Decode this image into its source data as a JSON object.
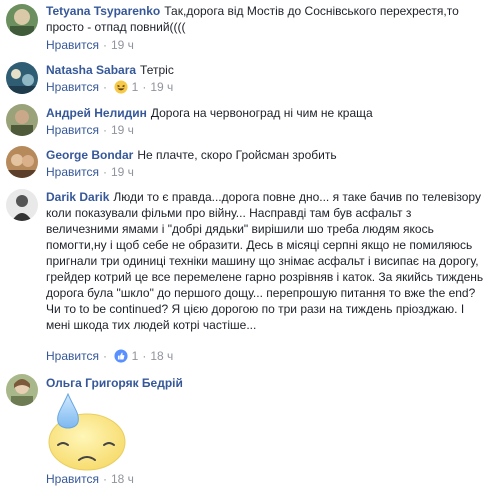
{
  "comments": [
    {
      "name": "Tetyana Tsyparenko",
      "text": "Так,дорога від Мостів до Соснівського перехрестя,то просто - отпад повний((((",
      "like_label": "Нравится",
      "time": "19 ч"
    },
    {
      "name": "Natasha Sabara",
      "text": "Тетріс",
      "like_label": "Нравится",
      "reaction_count": "1",
      "time": "19 ч"
    },
    {
      "name": "Андрей Нелидин",
      "text": "Дорога на червоноград ні чим не краща",
      "like_label": "Нравится",
      "time": "19 ч"
    },
    {
      "name": "George Bondar",
      "text": "Не плачте, скоро Гройсман зробить",
      "like_label": "Нравится",
      "time": "19 ч"
    },
    {
      "name": "Darik Darik",
      "text": "Люди то є правда...дорога повне дно... я таке бачив по телевізору коли показували фільми про війну... Насправді там був асфальт з величезними ямами і \"добрі дядьки\" вирішили шо треба людям якось помогти,ну і щоб себе не образити. Десь в місяці серпні якщо не помиляюсь пригнали три одиниці техніки машину що знімає асфальт і висипає на дорогу, грейдер котрий це все перемелене гарно розрівняв і каток. За якийсь тиждень дорога була \"шкло\" до першого дощу... перепрошую питання то вже the end? Чи то to be continued? Я цією дорогою по три рази на тиждень пріозджаю. І мені шкода тих людей котрі частіше...",
      "like_label": "Нравится",
      "reaction_count": "1",
      "time": "18 ч"
    },
    {
      "name": "Ольга Григоряк Бедрій",
      "text": "",
      "like_label": "Нравится",
      "time": "18 ч"
    }
  ],
  "colors": {
    "name": "#365899",
    "meta": "#90949c",
    "text": "#1d2129",
    "like_reaction": "#5890ff"
  }
}
